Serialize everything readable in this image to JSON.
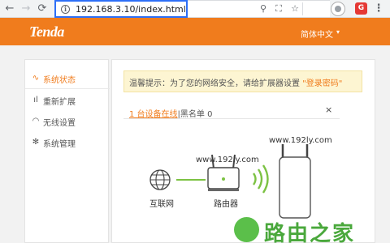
{
  "browser": {
    "url": "192.168.3.10/index.html",
    "back_icon": "arrow-left-icon",
    "forward_icon": "arrow-right-icon",
    "reload_icon": "reload-icon",
    "info_icon": "info-icon",
    "info_symbol": "i",
    "toolbar_icons": [
      "zoom-icon",
      "translate-icon",
      "star-icon",
      "extension-icon",
      "adblock-icon",
      "menu-icon"
    ],
    "adblock_symbol": "G",
    "accent_color": "#2d6ff7"
  },
  "header": {
    "logo": "Tenda",
    "language": "简体中文",
    "lang_caret": "▾",
    "brand_color": "#f07c1d"
  },
  "sidebar": {
    "items": [
      {
        "label": "系统状态",
        "icon": "pulse-icon",
        "active": true
      },
      {
        "label": "重新扩展",
        "icon": "signal-icon",
        "active": false
      },
      {
        "label": "无线设置",
        "icon": "wifi-icon",
        "active": false
      },
      {
        "label": "系统管理",
        "icon": "gear-icon",
        "active": false
      }
    ]
  },
  "main": {
    "notice_prefix": "温馨提示：为了您的网络安全，请给扩展器设置 ",
    "notice_link": "\"登录密码\"",
    "devices_online": "1 台设备在线",
    "separator": "|",
    "blacklist": "黑名单 0",
    "close_symbol": "×",
    "extender_label": "www.192ly.com",
    "router_ssid_label": "www.192ly.com",
    "internet_label": "互联网",
    "router_label": "路由器"
  },
  "watermark": {
    "text": "路由之家"
  }
}
